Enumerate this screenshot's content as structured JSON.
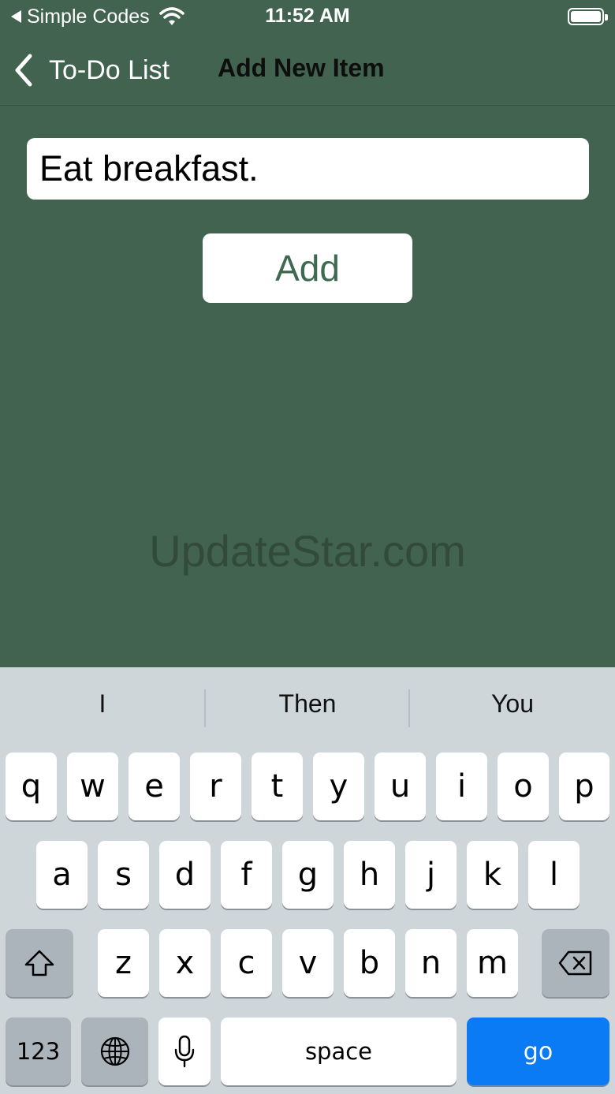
{
  "status_bar": {
    "back_app": "Simple Codes",
    "time": "11:52 AM"
  },
  "nav": {
    "back_label": "To-Do List",
    "title": "Add New Item"
  },
  "form": {
    "item_value": "Eat breakfast.",
    "add_label": "Add"
  },
  "watermark": "UpdateStar.com",
  "keyboard": {
    "suggestions": [
      "I",
      "Then",
      "You"
    ],
    "row1": [
      "q",
      "w",
      "e",
      "r",
      "t",
      "y",
      "u",
      "i",
      "o",
      "p"
    ],
    "row2": [
      "a",
      "s",
      "d",
      "f",
      "g",
      "h",
      "j",
      "k",
      "l"
    ],
    "row3": [
      "z",
      "x",
      "c",
      "v",
      "b",
      "n",
      "m"
    ],
    "numbers_label": "123",
    "space_label": "space",
    "go_label": "go"
  },
  "colors": {
    "background": "#41634f",
    "go_key": "#0b7bf5",
    "add_text": "#3f6a52"
  }
}
